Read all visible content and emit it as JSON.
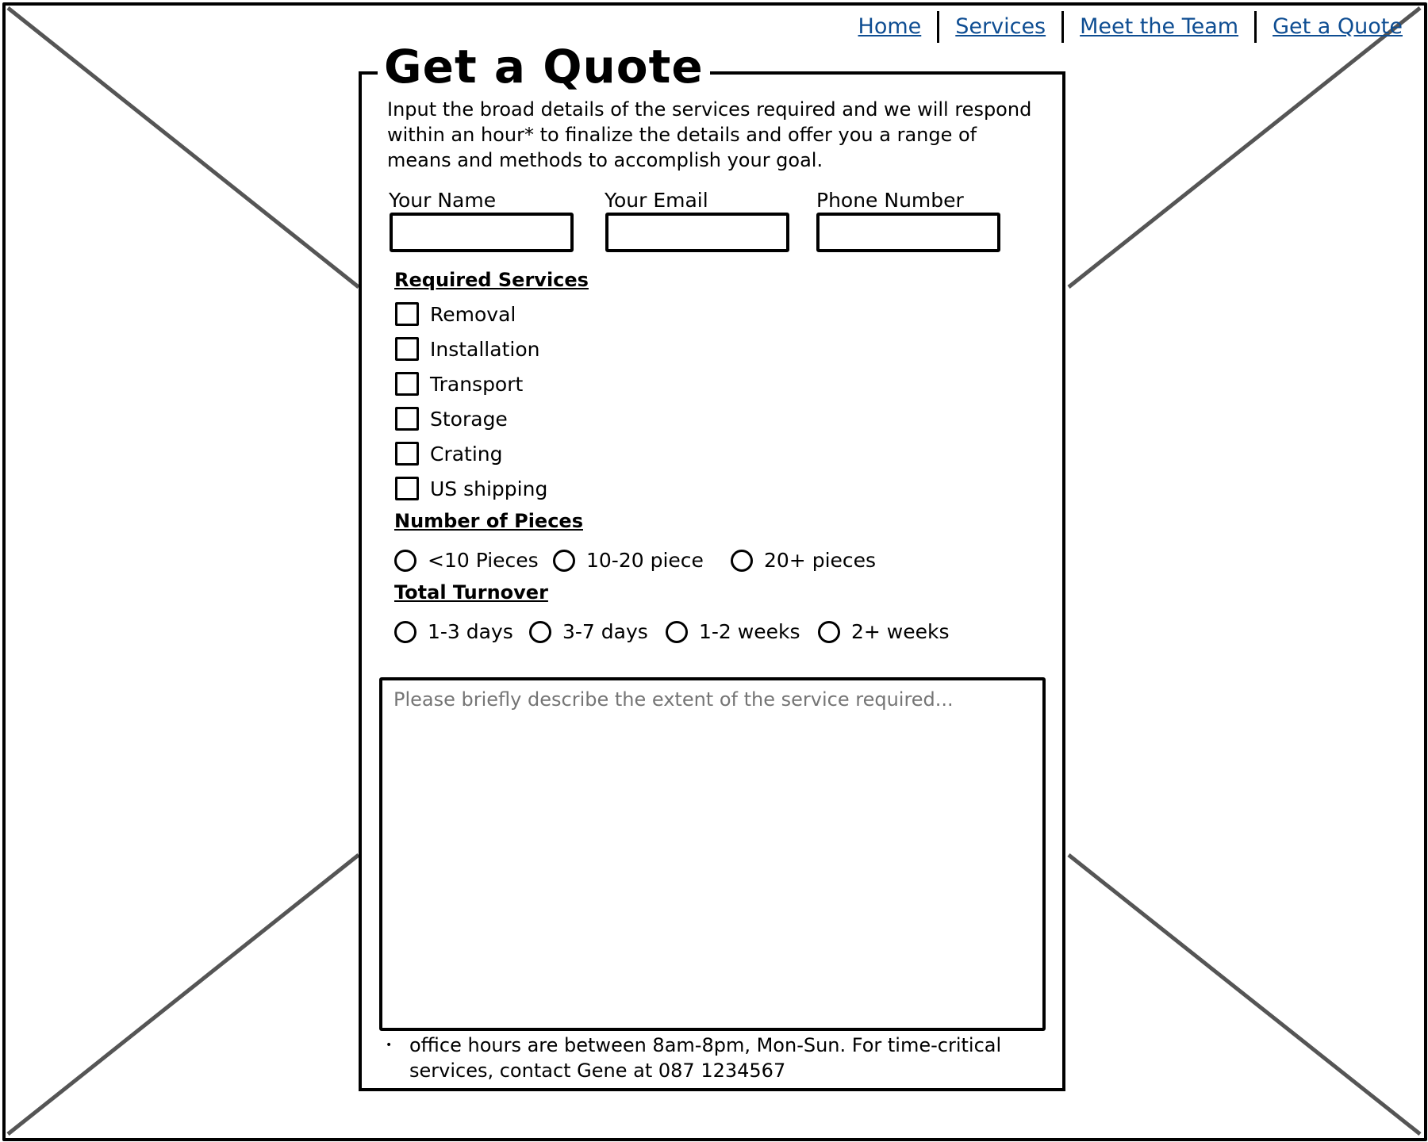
{
  "nav": {
    "items": [
      "Home",
      "Services",
      "Meet the Team",
      "Get a Quote"
    ]
  },
  "form": {
    "title": "Get a Quote",
    "intro": "Input the broad details of the services required and we will respond within an hour* to finalize the details and offer you a range of means and methods to accomplish your goal.",
    "fields": [
      {
        "label": "Your Name",
        "value": ""
      },
      {
        "label": "Your Email",
        "value": ""
      },
      {
        "label": "Phone Number",
        "value": ""
      }
    ],
    "services_title": "Required Services",
    "services": [
      "Removal",
      "Installation",
      "Transport",
      "Storage",
      "Crating",
      "US shipping"
    ],
    "pieces_title": "Number of Pieces",
    "pieces": [
      "<10 Pieces",
      "10-20 piece",
      "20+ pieces"
    ],
    "turnover_title": "Total Turnover",
    "turnover": [
      "1-3 days",
      "3-7 days",
      "1-2 weeks",
      "2+ weeks"
    ],
    "description_placeholder": "Please briefly describe the extent of the service required...",
    "note": "office hours are between 8am-8pm, Mon-Sun. For time-critical services, contact Gene at 087 1234567"
  },
  "colors": {
    "link": "#0e4d92",
    "placeholder": "#999999",
    "xlines": "#555555"
  }
}
